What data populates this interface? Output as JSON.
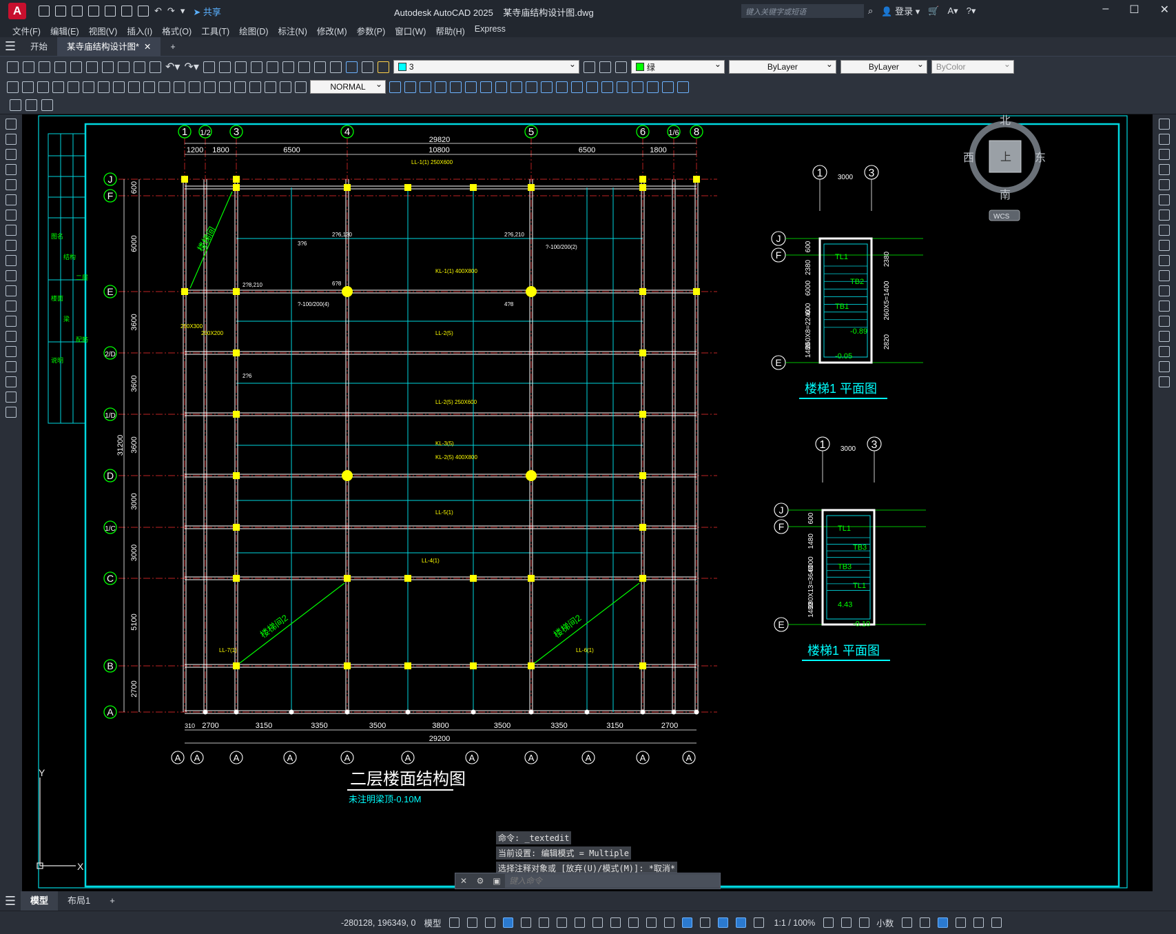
{
  "app": {
    "logo": "A",
    "title": "Autodesk AutoCAD 2025",
    "filename": "某寺庙结构设计图.dwg",
    "share": "共享",
    "search_placeholder": "键入关键字或短语",
    "login": "登录"
  },
  "menu": [
    "文件(F)",
    "编辑(E)",
    "视图(V)",
    "插入(I)",
    "格式(O)",
    "工具(T)",
    "绘图(D)",
    "标注(N)",
    "修改(M)",
    "参数(P)",
    "窗口(W)",
    "帮助(H)",
    "Express"
  ],
  "tabs": {
    "start": "开始",
    "doc": "某寺庙结构设计图*",
    "add": "+"
  },
  "properties": {
    "layer": "3",
    "color": "绿",
    "color_hex": "#00ff00",
    "linetype": "ByLayer",
    "lineweight": "ByLayer",
    "plotstyle": "ByColor",
    "dimstyle": "NORMAL"
  },
  "drawing": {
    "title": "二层楼面结构图",
    "subtitle": "未注明梁顶-0.10M",
    "grid_columns_top": [
      "1",
      "1/2",
      "3",
      "4",
      "5",
      "6",
      "1/6",
      "8"
    ],
    "top_dims": [
      "1200",
      "1800",
      "6500",
      "10800",
      "6500",
      "1800"
    ],
    "top_total": "29820",
    "bottom_dims": [
      "2700",
      "3150",
      "3350",
      "3500",
      "3800",
      "3500",
      "3350",
      "3150",
      "2700"
    ],
    "bottom_total": "29200",
    "bottom_offset": "310",
    "grid_rows": [
      "J",
      "F",
      "E",
      "2/D",
      "1/D",
      "D",
      "1/C",
      "C",
      "B",
      "A"
    ],
    "left_dims": [
      "600",
      "6000",
      "3600",
      "3600",
      "3600",
      "3000",
      "3000",
      "5100",
      "2700"
    ],
    "left_total": "31200",
    "bottom_axis_labels": [
      "A",
      "A",
      "A",
      "A",
      "A",
      "A",
      "A",
      "A",
      "A",
      "A",
      "A"
    ],
    "stair_room_label": "楼梯间",
    "stair_room_label_2": "楼梯间2",
    "beam_labels": [
      "LL-1(1) 250X600",
      "KL-1(1) 400X800",
      "LL-2(5)",
      "LL-2(5) 250X600",
      "KL-3(5)",
      "KL-2(5) 400X800",
      "LL-5(1)",
      "LL-4(1)",
      "LL-7(1)",
      "LL-6(1)",
      "250X300",
      "250X200"
    ],
    "slab_labels": [
      "2?6,130",
      "2?6,210",
      "2?8,210",
      "3?6",
      "?-100/200(2)",
      "?-100/200(4)",
      "4?8",
      "6?8",
      "2?6"
    ],
    "stair1": {
      "title": "楼梯1 平面图",
      "axes": [
        "1",
        "3"
      ],
      "axis_dim": "3000",
      "rows": [
        "J",
        "F",
        "E"
      ],
      "left_dims": [
        "600",
        "2380",
        "6000",
        "600",
        "260X8=2240",
        "1480"
      ],
      "right_dims": [
        "2380",
        "260X5=1400",
        "2820"
      ],
      "labels": [
        "TL1",
        "TB2",
        "TB1",
        "-0.89",
        "-0.05"
      ]
    },
    "stair2": {
      "title": "楼梯1 平面图",
      "axes": [
        "1",
        "3"
      ],
      "axis_dim": "3000",
      "rows": [
        "J",
        "F",
        "E"
      ],
      "left_dims": [
        "600",
        "1480",
        "6000",
        "280X13=3640",
        "1480"
      ],
      "labels": [
        "TL1",
        "TB3",
        "TB3",
        "TL1",
        "4.43",
        "-0.10"
      ]
    },
    "viewcube": {
      "north": "北",
      "south": "南",
      "east": "东",
      "west": "西",
      "face": "上",
      "wcs": "WCS"
    },
    "ucs": {
      "y": "Y",
      "x": "X"
    },
    "legend_text": [
      "图名",
      "结构",
      "二层",
      "楼面",
      "梁",
      "配筋",
      "说明"
    ]
  },
  "command_history": [
    "命令: _textedit",
    "当前设置: 编辑模式 = Multiple",
    "选择注释对象或 [放弃(U)/模式(M)]: *取消*"
  ],
  "command_placeholder": "键入命令",
  "layout_tabs": {
    "model": "模型",
    "layout1": "布局1",
    "add": "+"
  },
  "status": {
    "coords": "-280128, 196349, 0",
    "space": "模型",
    "scale": "1:1 / 100%",
    "units": "小数"
  }
}
